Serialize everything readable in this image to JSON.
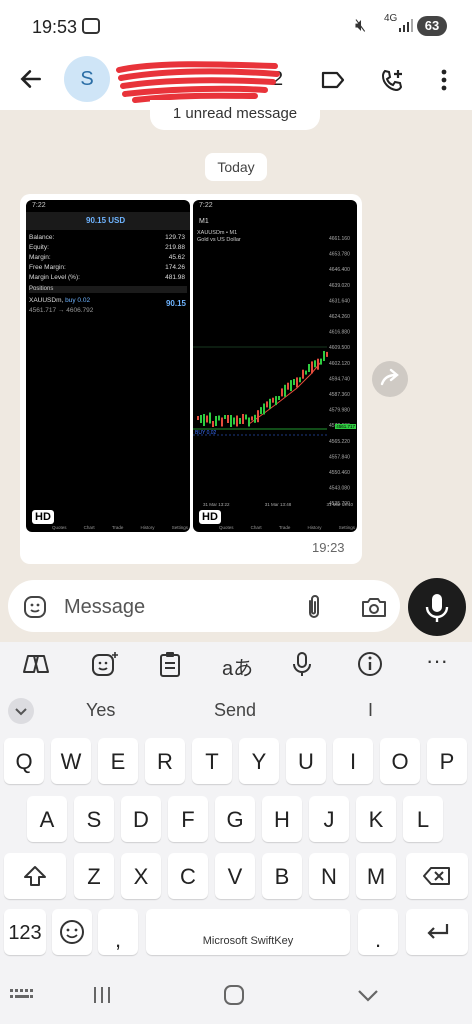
{
  "status_bar": {
    "time": "19:53",
    "network": "4G",
    "battery": "63"
  },
  "header": {
    "avatar_letter": "S",
    "contact_visible_suffix": "2"
  },
  "chat": {
    "unread_banner": "1 unread message",
    "date_chip": "Today",
    "message_time": "19:23",
    "left_shot": {
      "time": "7:22",
      "balance_header": "90.15 USD",
      "rows": [
        {
          "label": "Balance:",
          "value": "129.73"
        },
        {
          "label": "Equity:",
          "value": "219.88"
        },
        {
          "label": "Margin:",
          "value": "45.62"
        },
        {
          "label": "Free Margin:",
          "value": "174.26"
        },
        {
          "label": "Margin Level (%):",
          "value": "481.98"
        }
      ],
      "positions_label": "Positions",
      "position_symbol": "XAUUSDm",
      "position_side": "buy 0.02",
      "position_profit": "90.15",
      "position_prices": "4561.717 → 4606.792",
      "hd": "HD",
      "tabs": [
        "Quotes",
        "Chart",
        "Trade",
        "History",
        "Settings"
      ]
    },
    "right_shot": {
      "time": "7:22",
      "timeframe": "M1",
      "symbol_line": "XAUUSDm • M1",
      "desc_line": "Gold vs US Dollar",
      "price_labels": [
        "4661.160",
        "4653.780",
        "4646.400",
        "4639.020",
        "4631.640",
        "4624.260",
        "4616.880",
        "4609.500",
        "4602.120",
        "4594.740",
        "4587.360",
        "4579.980",
        "4572.600",
        "4565.220",
        "4557.840",
        "4550.460",
        "4543.080",
        "4535.700"
      ],
      "bid_line_label": "4561.717",
      "buy_label": "BUY 0.02",
      "time_labels": [
        "31 Mar 13:22",
        "31 Mar 13:48",
        "31 Mar 14:10"
      ],
      "hd": "HD",
      "tabs": [
        "Quotes",
        "Chart",
        "Trade",
        "History",
        "Settings"
      ]
    }
  },
  "input": {
    "placeholder": "Message"
  },
  "keyboard": {
    "suggestions": [
      "Yes",
      "Send",
      "I"
    ],
    "row1": [
      "Q",
      "W",
      "E",
      "R",
      "T",
      "Y",
      "U",
      "I",
      "O",
      "P"
    ],
    "row2": [
      "A",
      "S",
      "D",
      "F",
      "G",
      "H",
      "J",
      "K",
      "L"
    ],
    "row3": [
      "Z",
      "X",
      "C",
      "V",
      "B",
      "N",
      "M"
    ],
    "num_key": "123",
    "comma": ",",
    "period": ".",
    "space_label": "Microsoft SwiftKey"
  },
  "colors": {
    "accent_dark": "#1c1c1c",
    "chart_green": "#2ecc40",
    "chart_red": "#e74c3c",
    "chat_bg": "#efe9e1"
  },
  "icons": [
    "screen-record-icon",
    "mute-icon",
    "signal-icon",
    "back-arrow-icon",
    "label-icon",
    "add-call-icon",
    "more-vert-icon",
    "sticker-icon",
    "attach-icon",
    "camera-icon",
    "mic-icon",
    "forward-icon",
    "copilot-icon",
    "emoji-sparkle-icon",
    "clipboard-icon",
    "translate-icon",
    "keyboard-mic-icon",
    "info-icon",
    "ellipsis-icon",
    "shift-icon",
    "backspace-icon",
    "emoji-icon",
    "enter-icon",
    "recents-icon",
    "home-icon",
    "nav-back-icon",
    "keyboard-hide-icon"
  ]
}
